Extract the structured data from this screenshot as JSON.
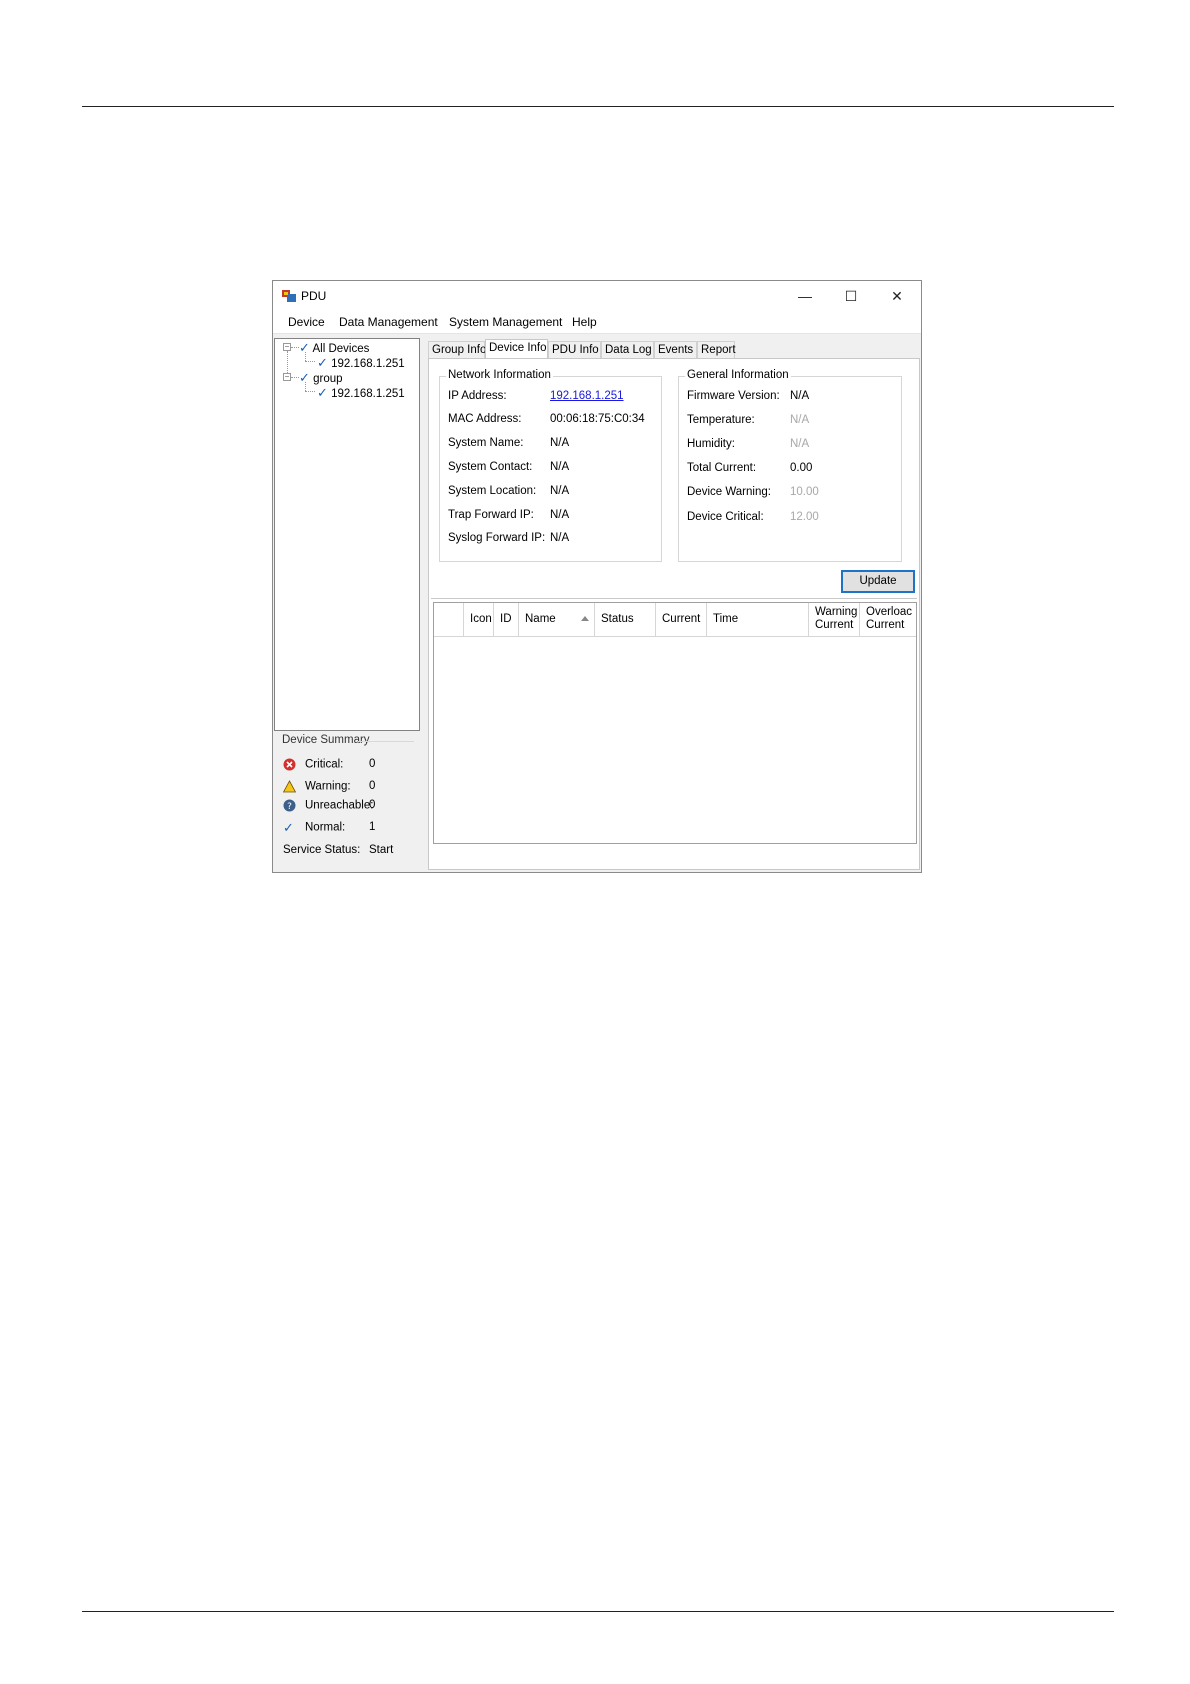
{
  "window": {
    "title": "PDU",
    "controls": {
      "minimize": "—",
      "maximize": "☐",
      "close": "✕"
    }
  },
  "menu": [
    "Device",
    "Data Management",
    "System Management",
    "Help"
  ],
  "tree": {
    "all_devices": "All Devices",
    "all_devices_child": "192.168.1.251",
    "group": "group",
    "group_child": "192.168.1.251"
  },
  "summary": {
    "title": "Device Summary",
    "critical": {
      "label": "Critical:",
      "value": "0"
    },
    "warning": {
      "label": "Warning:",
      "value": "0"
    },
    "unreachable": {
      "label": "Unreachable:",
      "value": "0"
    },
    "normal": {
      "label": "Normal:",
      "value": "1"
    },
    "service": {
      "label": "Service Status:",
      "value": "Start"
    }
  },
  "tabs": [
    "Group Info",
    "Device Info",
    "PDU Info",
    "Data Log",
    "Events",
    "Report"
  ],
  "active_tab": "Device Info",
  "network": {
    "title": "Network Information",
    "ip_label": "IP Address:",
    "ip": "192.168.1.251",
    "mac_label": "MAC Address:",
    "mac": "00:06:18:75:C0:34",
    "sysname_label": "System Name:",
    "sysname": "N/A",
    "contact_label": "System Contact:",
    "contact": "N/A",
    "location_label": "System Location:",
    "location": "N/A",
    "trap_label": "Trap Forward IP:",
    "trap": "N/A",
    "syslog_label": "Syslog Forward IP:",
    "syslog": "N/A"
  },
  "general": {
    "title": "General Information",
    "fw_label": "Firmware Version:",
    "fw": "N/A",
    "temp_label": "Temperature:",
    "temp": "N/A",
    "hum_label": "Humidity:",
    "hum": "N/A",
    "total_label": "Total Current:",
    "total": "0.00",
    "warn_label": "Device Warning:",
    "warn": "10.00",
    "crit_label": "Device Critical:",
    "crit": "12.00"
  },
  "update_label": "Update",
  "columns": {
    "icon": "Icon",
    "id": "ID",
    "name": "Name",
    "status": "Status",
    "current": "Current",
    "time": "Time",
    "warning_1": "Warning",
    "warning_2": "Current",
    "overload_1": "Overloac",
    "overload_2": "Current"
  },
  "colors": {
    "link": "#1a1adf",
    "check": "#1a5fb4",
    "focus_border": "#1e73c8"
  }
}
